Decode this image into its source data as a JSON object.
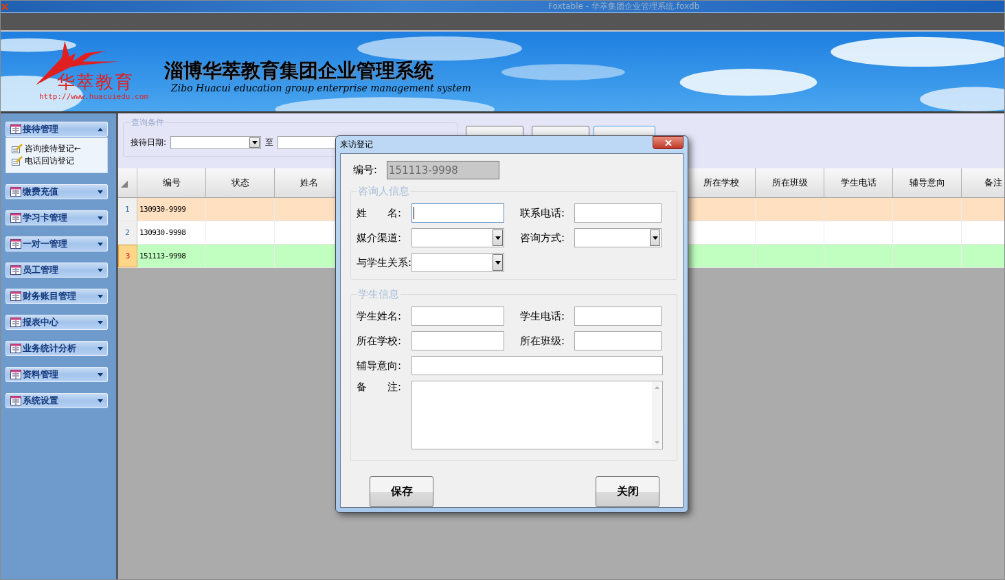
{
  "window": {
    "title": "Foxtable - 华萃集团企业管理系统.foxdb"
  },
  "banner": {
    "logo_text": "华萃教育",
    "logo_url": "http://www.huacuiedu.com",
    "title": "淄博华萃教育集团企业管理系统",
    "subtitle": "Zibo Huacui education group enterprise management system"
  },
  "sidebar": {
    "groups": [
      {
        "label": "接待管理",
        "expanded": true,
        "children": [
          {
            "label": "咨询接待登记←"
          },
          {
            "label": "电话回访登记"
          }
        ]
      },
      {
        "label": "缴费充值",
        "expanded": false
      },
      {
        "label": "学习卡管理",
        "expanded": false
      },
      {
        "label": "一对一管理",
        "expanded": false
      },
      {
        "label": "员工管理",
        "expanded": false
      },
      {
        "label": "财务账目管理",
        "expanded": false
      },
      {
        "label": "报表中心",
        "expanded": false
      },
      {
        "label": "业务统计分析",
        "expanded": false
      },
      {
        "label": "资料管理",
        "expanded": false
      },
      {
        "label": "系统设置",
        "expanded": false
      }
    ]
  },
  "query": {
    "title": "查询条件",
    "date_label": "接待日期:",
    "to_label": "至",
    "buttons": [
      {
        "default": false
      },
      {
        "default": false
      },
      {
        "default": true
      }
    ]
  },
  "table": {
    "columns_left": [
      "编号",
      "状态",
      "姓名"
    ],
    "columns_right": [
      "所在学校",
      "所在班级",
      "学生电话",
      "辅导意向",
      "备注"
    ],
    "rows": [
      {
        "number": "1",
        "id": "130930-9999",
        "color": "#ffe0c0",
        "selected": false
      },
      {
        "number": "2",
        "id": "130930-9998",
        "color": "#ffffff",
        "selected": false
      },
      {
        "number": "3",
        "id": "151113-9998",
        "color": "#c0ffc0",
        "selected": true
      }
    ]
  },
  "dialog": {
    "title": "来访登记",
    "id_label": "编号:",
    "id_value": "151113-9998",
    "id_disabled": true,
    "sections": [
      {
        "title": "咨询人信息",
        "rows": [
          {
            "fields": [
              {
                "label": "姓　　名:",
                "kind": "text",
                "focused": true
              },
              {
                "label": "联系电话:",
                "kind": "text",
                "focused": false
              }
            ]
          },
          {
            "fields": [
              {
                "label": "媒介渠道:",
                "kind": "combo",
                "focused": false
              },
              {
                "label": "咨询方式:",
                "kind": "combo",
                "focused": false
              }
            ]
          },
          {
            "fields": [
              {
                "label": "与学生关系:",
                "kind": "combo",
                "focused": false
              }
            ]
          }
        ]
      },
      {
        "title": "学生信息",
        "rows": [
          {
            "fields": [
              {
                "label": "学生姓名:",
                "kind": "text",
                "focused": false
              },
              {
                "label": "学生电话:",
                "kind": "text",
                "focused": false
              }
            ]
          },
          {
            "fields": [
              {
                "label": "所在学校:",
                "kind": "text",
                "focused": false
              },
              {
                "label": "所在班级:",
                "kind": "text",
                "focused": false
              }
            ]
          },
          {
            "fields": [
              {
                "label": "辅导意向:",
                "kind": "wide",
                "focused": false
              }
            ]
          },
          {
            "fields": [
              {
                "label": "备　　注:",
                "kind": "memo",
                "focused": false
              }
            ]
          }
        ]
      }
    ],
    "buttons": [
      "保存",
      "关闭"
    ]
  }
}
